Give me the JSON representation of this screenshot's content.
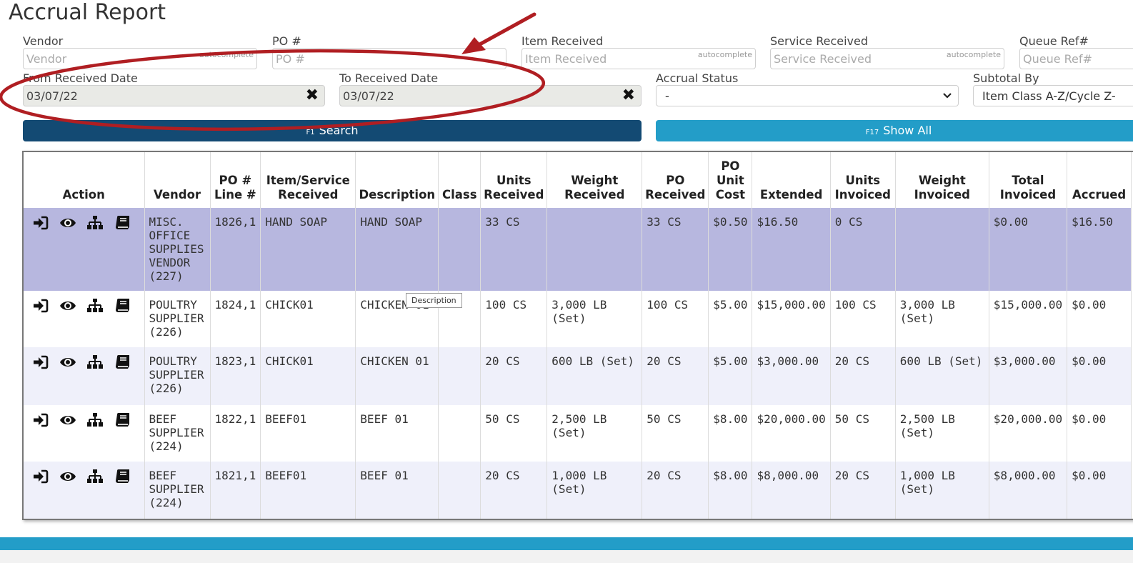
{
  "page": {
    "title": "Accrual Report"
  },
  "filters": {
    "vendor": {
      "label": "Vendor",
      "placeholder": "Vendor",
      "hint": "autocomplete"
    },
    "po": {
      "label": "PO #",
      "placeholder": "PO #"
    },
    "item": {
      "label": "Item Received",
      "placeholder": "Item Received",
      "hint": "autocomplete"
    },
    "service": {
      "label": "Service Received",
      "placeholder": "Service Received",
      "hint": "autocomplete"
    },
    "queue": {
      "label": "Queue Ref#",
      "placeholder": "Queue Ref#"
    },
    "from_date": {
      "label": "From Received Date",
      "value": "03/07/22"
    },
    "to_date": {
      "label": "To Received Date",
      "value": "03/07/22"
    },
    "accrual_status": {
      "label": "Accrual Status",
      "value": "-"
    },
    "subtotal_by": {
      "label": "Subtotal By",
      "value": "Item Class A-Z/Cycle Z-"
    }
  },
  "buttons": {
    "search": {
      "key": "F1",
      "label": "Search"
    },
    "show_all": {
      "key": "F17",
      "label": "Show All"
    }
  },
  "table": {
    "headers": {
      "action": "Action",
      "vendor": "Vendor",
      "po_line": [
        "PO #",
        "Line #"
      ],
      "item": [
        "Item/Service",
        "Received"
      ],
      "description": "Description",
      "class": "Class",
      "units_received": [
        "Units",
        "Received"
      ],
      "weight_received": [
        "Weight",
        "Received"
      ],
      "po_received": [
        "PO",
        "Received"
      ],
      "po_unit_cost": [
        "PO",
        "Unit",
        "Cost"
      ],
      "extended": "Extended",
      "units_invoiced": [
        "Units",
        "Invoiced"
      ],
      "weight_invoiced": [
        "Weight",
        "Invoiced"
      ],
      "total_invoiced": [
        "Total",
        "Invoiced"
      ],
      "accrued": "Accrued"
    },
    "rows": [
      {
        "vendor": "MISC. OFFICE SUPPLIES VENDOR (227)",
        "po_line": "1826,1",
        "item": "HAND SOAP",
        "description": "HAND SOAP",
        "class": "",
        "units_received": "33 CS",
        "weight_received": "",
        "po_received": "33 CS",
        "po_unit_cost": "$0.50",
        "extended": "$16.50",
        "units_invoiced": "0 CS",
        "weight_invoiced": "",
        "total_invoiced": "$0.00",
        "accrued": "$16.50"
      },
      {
        "vendor": "POULTRY SUPPLIER (226)",
        "po_line": "1824,1",
        "item": "CHICK01",
        "description": "CHICKEN 01",
        "class": "",
        "units_received": "100 CS",
        "weight_received": "3,000 LB (Set)",
        "po_received": "100 CS",
        "po_unit_cost": "$5.00",
        "extended": "$15,000.00",
        "units_invoiced": "100 CS",
        "weight_invoiced": "3,000 LB (Set)",
        "total_invoiced": "$15,000.00",
        "accrued": "$0.00"
      },
      {
        "vendor": "POULTRY SUPPLIER (226)",
        "po_line": "1823,1",
        "item": "CHICK01",
        "description": "CHICKEN 01",
        "class": "",
        "units_received": "20 CS",
        "weight_received": "600 LB (Set)",
        "po_received": "20 CS",
        "po_unit_cost": "$5.00",
        "extended": "$3,000.00",
        "units_invoiced": "20 CS",
        "weight_invoiced": "600 LB (Set)",
        "total_invoiced": "$3,000.00",
        "accrued": "$0.00"
      },
      {
        "vendor": "BEEF SUPPLIER (224)",
        "po_line": "1822,1",
        "item": "BEEF01",
        "description": "BEEF 01",
        "class": "",
        "units_received": "50 CS",
        "weight_received": "2,500 LB (Set)",
        "po_received": "50 CS",
        "po_unit_cost": "$8.00",
        "extended": "$20,000.00",
        "units_invoiced": "50 CS",
        "weight_invoiced": "2,500 LB (Set)",
        "total_invoiced": "$20,000.00",
        "accrued": "$0.00"
      },
      {
        "vendor": "BEEF SUPPLIER (224)",
        "po_line": "1821,1",
        "item": "BEEF01",
        "description": "BEEF 01",
        "class": "",
        "units_received": "20 CS",
        "weight_received": "1,000 LB (Set)",
        "po_received": "20 CS",
        "po_unit_cost": "$8.00",
        "extended": "$8,000.00",
        "units_invoiced": "20 CS",
        "weight_invoiced": "1,000 LB (Set)",
        "total_invoiced": "$8,000.00",
        "accrued": "$0.00"
      }
    ]
  },
  "tooltip": {
    "text": "Description"
  },
  "colors": {
    "selected_row": "#b7b7df",
    "alt_row": "#eff0fa",
    "search_button": "#134a73",
    "show_all_button": "#239dc8",
    "annotation": "#b01e22"
  },
  "icons": [
    "sign-in-icon",
    "eye-icon",
    "sitemap-icon",
    "book-icon"
  ]
}
